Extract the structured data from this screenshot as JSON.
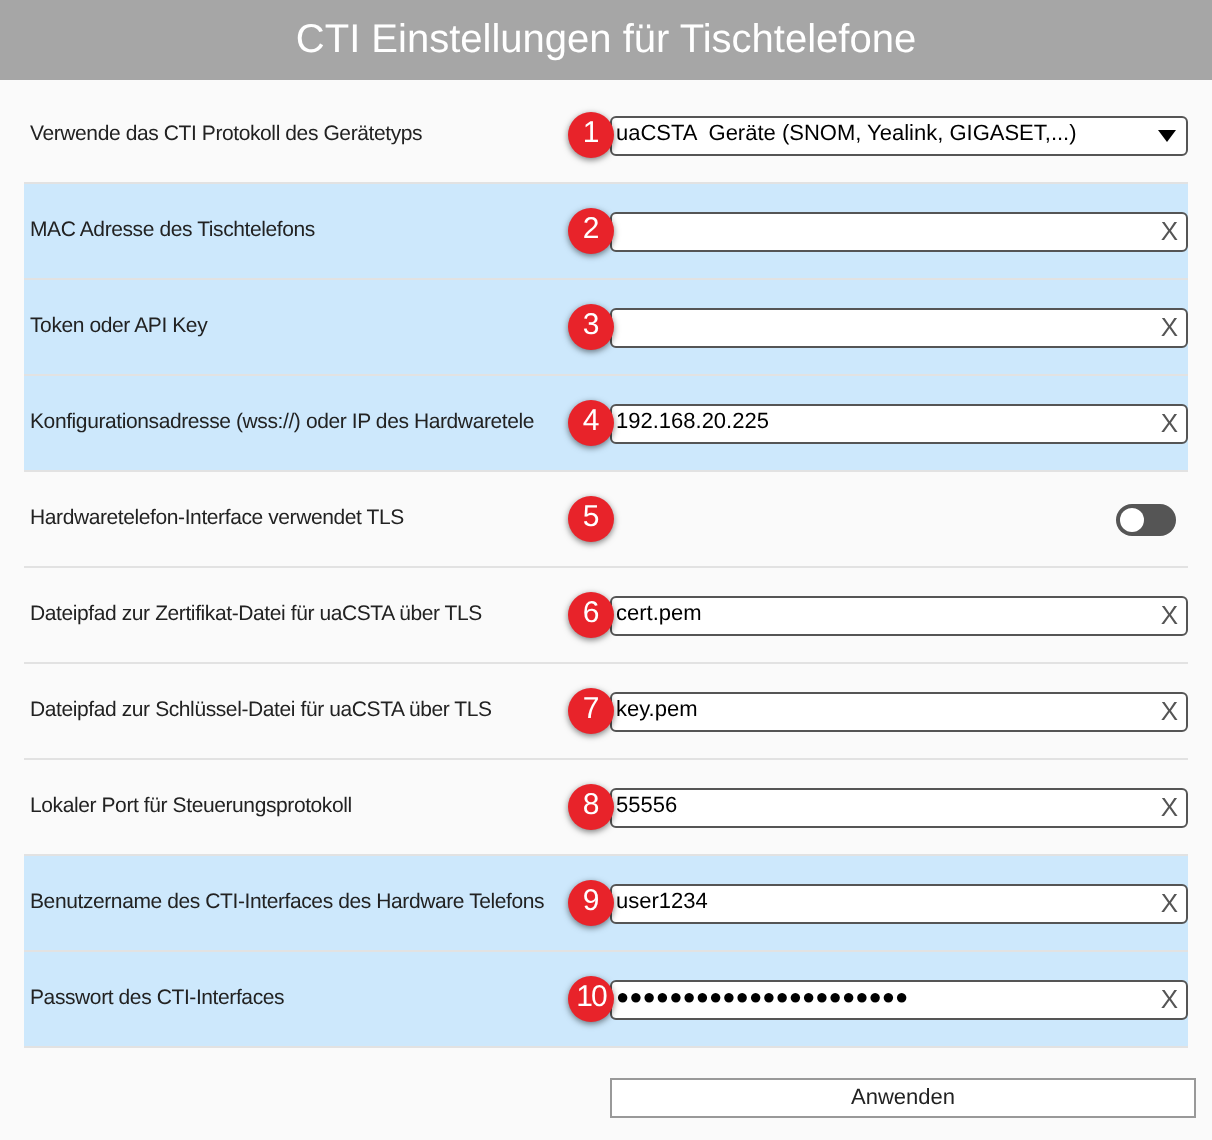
{
  "window": {
    "title": "CTI Einstellungen für Tischtelefone"
  },
  "rows": [
    {
      "kind": "select",
      "label": "Verwende das CTI Protokoll des Gerätetyps",
      "badge": "1",
      "highlighted": false,
      "value": "uaCSTA  Geräte (SNOM, Yealink, GIGASET,...)"
    },
    {
      "kind": "text",
      "label": "MAC Adresse des Tischtelefons",
      "badge": "2",
      "highlighted": true,
      "clear": "X"
    },
    {
      "kind": "text",
      "label": "Token oder API Key",
      "badge": "3",
      "highlighted": true,
      "clear": "X"
    },
    {
      "kind": "text",
      "label": "Konfigurationsadresse (wss://) oder IP des Hardwaretele",
      "badge": "4",
      "highlighted": true,
      "value": "192.168.20.225",
      "clear": "X"
    },
    {
      "kind": "toggle",
      "label": "Hardwaretelefon-Interface verwendet TLS",
      "badge": "5",
      "highlighted": false,
      "on": false
    },
    {
      "kind": "text",
      "label": "Dateipfad zur Zertifikat-Datei für uaCSTA über TLS",
      "badge": "6",
      "highlighted": false,
      "value": "cert.pem",
      "clear": "X"
    },
    {
      "kind": "text",
      "label": "Dateipfad zur Schlüssel-Datei für uaCSTA über TLS",
      "badge": "7",
      "highlighted": false,
      "value": "key.pem",
      "clear": "X"
    },
    {
      "kind": "text",
      "label": "Lokaler Port für Steuerungsprotokoll",
      "badge": "8",
      "highlighted": false,
      "value": "55556",
      "clear": "X"
    },
    {
      "kind": "text",
      "label": "Benutzername des CTI-Interfaces des Hardware Telefons",
      "badge": "9",
      "highlighted": true,
      "value": "user1234",
      "clear": "X"
    },
    {
      "kind": "text",
      "label": "Passwort des CTI-Interfaces",
      "badge": "10",
      "highlighted": true,
      "value": "●●●●●●●●●●●●●●●●●●●●●●",
      "clear": "X"
    }
  ],
  "buttons": [
    "Anwenden"
  ]
}
